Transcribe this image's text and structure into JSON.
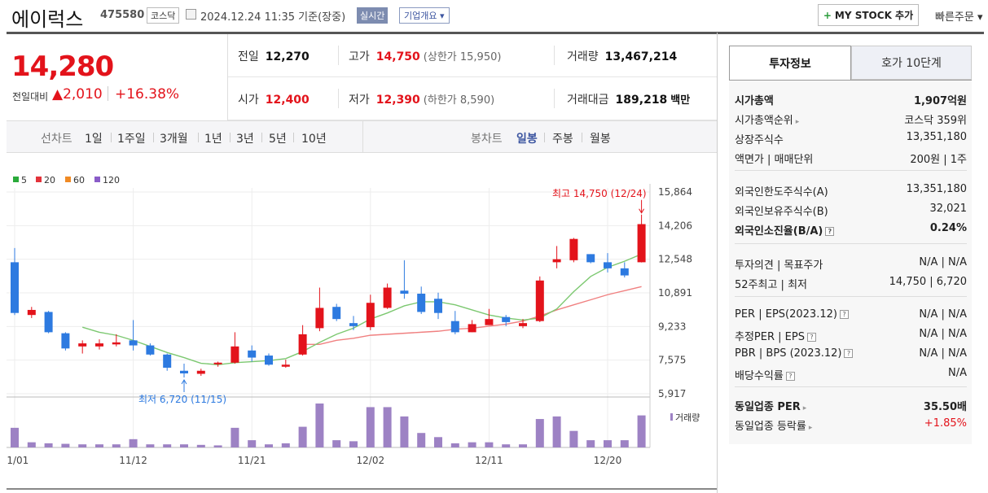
{
  "header": {
    "company_name": "에이럭스",
    "stock_code": "475580",
    "market": "코스닥",
    "datetime": "2024.12.24 11:35 기준(장중)",
    "realtime_badge": "실시간",
    "company_info_btn": "기업개요 ▾",
    "mystock_btn": "MY STOCK 추가",
    "quick_order": "빠른주문 ▾"
  },
  "price": {
    "current": "14,280",
    "diff_label": "전일대비",
    "diff_value": "▲2,010",
    "diff_pct": "+16.38%"
  },
  "stats": {
    "prev_close_label": "전일",
    "prev_close": "12,270",
    "high_label": "고가",
    "high": "14,750",
    "upper_limit": "(상한가 15,950)",
    "volume_label": "거래량",
    "volume": "13,467,214",
    "open_label": "시가",
    "open": "12,400",
    "low_label": "저가",
    "low": "12,390",
    "lower_limit": "(하한가 8,590)",
    "amount_label": "거래대금",
    "amount": "189,218",
    "amount_unit": "백만"
  },
  "period_bar": {
    "line_label": "선차트",
    "line_items": [
      "1일",
      "1주일",
      "3개월",
      "1년",
      "3년",
      "5년",
      "10년"
    ],
    "candle_label": "봉차트",
    "candle_items": [
      "일봉",
      "주봉",
      "월봉"
    ],
    "candle_selected": 0
  },
  "chart_data": {
    "type": "candlestick",
    "legend": [
      {
        "name": "5",
        "color": "#2aaa3a"
      },
      {
        "name": "20",
        "color": "#e3333b"
      },
      {
        "name": "60",
        "color": "#f08a24"
      },
      {
        "name": "120",
        "color": "#8a5cc8"
      }
    ],
    "y_ticks": [
      "15,864",
      "14,206",
      "12,548",
      "10,891",
      "9,233",
      "7,575",
      "5,917"
    ],
    "ylim": [
      5917,
      15864
    ],
    "x_ticks": [
      {
        "label": "11/01",
        "index": 0
      },
      {
        "label": "11/12",
        "index": 7
      },
      {
        "label": "11/21",
        "index": 14
      },
      {
        "label": "12/02",
        "index": 21
      },
      {
        "label": "12/11",
        "index": 28
      },
      {
        "label": "12/20",
        "index": 35
      }
    ],
    "volume_label": "거래량",
    "high_annotation": "최고 14,750 (12/24)",
    "low_annotation": "최저 6,720 (11/15)",
    "up_color": "#e3131b",
    "down_color": "#2d7ae0",
    "candles": [
      {
        "o": 12400,
        "h": 13100,
        "l": 9800,
        "c": 9900,
        "v": 38
      },
      {
        "o": 9800,
        "h": 10200,
        "l": 9650,
        "c": 10050,
        "v": 10
      },
      {
        "o": 9950,
        "h": 10000,
        "l": 8900,
        "c": 8950,
        "v": 8
      },
      {
        "o": 8900,
        "h": 8950,
        "l": 8050,
        "c": 8150,
        "v": 7
      },
      {
        "o": 8250,
        "h": 8550,
        "l": 7900,
        "c": 8400,
        "v": 6
      },
      {
        "o": 8250,
        "h": 8600,
        "l": 8100,
        "c": 8400,
        "v": 6
      },
      {
        "o": 8350,
        "h": 8850,
        "l": 8250,
        "c": 8450,
        "v": 6
      },
      {
        "o": 8550,
        "h": 9550,
        "l": 8050,
        "c": 8300,
        "v": 16
      },
      {
        "o": 8300,
        "h": 8400,
        "l": 7800,
        "c": 7850,
        "v": 6
      },
      {
        "o": 7850,
        "h": 7900,
        "l": 7050,
        "c": 7200,
        "v": 6
      },
      {
        "o": 7050,
        "h": 7400,
        "l": 6720,
        "c": 6920,
        "v": 6
      },
      {
        "o": 6900,
        "h": 7150,
        "l": 6800,
        "c": 7050,
        "v": 5
      },
      {
        "o": 7400,
        "h": 7500,
        "l": 7250,
        "c": 7450,
        "v": 4
      },
      {
        "o": 7450,
        "h": 8950,
        "l": 7400,
        "c": 8250,
        "v": 38
      },
      {
        "o": 8050,
        "h": 8300,
        "l": 7500,
        "c": 7700,
        "v": 14
      },
      {
        "o": 7800,
        "h": 7900,
        "l": 7300,
        "c": 7350,
        "v": 6
      },
      {
        "o": 7250,
        "h": 7600,
        "l": 7200,
        "c": 7350,
        "v": 8
      },
      {
        "o": 7850,
        "h": 9300,
        "l": 7800,
        "c": 8850,
        "v": 40
      },
      {
        "o": 9150,
        "h": 11150,
        "l": 9000,
        "c": 10150,
        "v": 85
      },
      {
        "o": 10200,
        "h": 10350,
        "l": 9500,
        "c": 9600,
        "v": 14
      },
      {
        "o": 9400,
        "h": 9750,
        "l": 9050,
        "c": 9250,
        "v": 12
      },
      {
        "o": 9200,
        "h": 10800,
        "l": 9050,
        "c": 10400,
        "v": 78
      },
      {
        "o": 10150,
        "h": 11350,
        "l": 10100,
        "c": 11150,
        "v": 78
      },
      {
        "o": 11000,
        "h": 12500,
        "l": 10600,
        "c": 10850,
        "v": 60
      },
      {
        "o": 10850,
        "h": 11200,
        "l": 9850,
        "c": 9950,
        "v": 28
      },
      {
        "o": 10600,
        "h": 10900,
        "l": 9600,
        "c": 9900,
        "v": 20
      },
      {
        "o": 9500,
        "h": 10000,
        "l": 8850,
        "c": 8950,
        "v": 8
      },
      {
        "o": 8950,
        "h": 9550,
        "l": 8950,
        "c": 9350,
        "v": 10
      },
      {
        "o": 9300,
        "h": 10100,
        "l": 9300,
        "c": 9600,
        "v": 10
      },
      {
        "o": 9700,
        "h": 9800,
        "l": 9250,
        "c": 9450,
        "v": 6
      },
      {
        "o": 9250,
        "h": 9600,
        "l": 9150,
        "c": 9400,
        "v": 6
      },
      {
        "o": 9500,
        "h": 11700,
        "l": 9450,
        "c": 11500,
        "v": 55
      },
      {
        "o": 12400,
        "h": 13200,
        "l": 12100,
        "c": 12550,
        "v": 60
      },
      {
        "o": 12500,
        "h": 13600,
        "l": 12400,
        "c": 13550,
        "v": 32
      },
      {
        "o": 12800,
        "h": 12800,
        "l": 12350,
        "c": 12400,
        "v": 14
      },
      {
        "o": 12400,
        "h": 12850,
        "l": 11900,
        "c": 12100,
        "v": 14
      },
      {
        "o": 12100,
        "h": 12400,
        "l": 11650,
        "c": 11750,
        "v": 14
      },
      {
        "o": 12400,
        "h": 14750,
        "l": 12390,
        "c": 14280,
        "v": 62
      }
    ],
    "ma5": [
      null,
      null,
      null,
      null,
      9200,
      8950,
      8800,
      8550,
      8250,
      7950,
      7700,
      7420,
      7350,
      7450,
      7500,
      7550,
      7650,
      8000,
      8450,
      8850,
      9150,
      9600,
      9900,
      10250,
      10450,
      10450,
      10300,
      10050,
      9800,
      9650,
      9550,
      9650,
      10100,
      10950,
      11700,
      12150,
      12450,
      12800
    ],
    "ma20": [
      null,
      null,
      null,
      null,
      null,
      null,
      null,
      null,
      null,
      null,
      null,
      null,
      null,
      null,
      null,
      null,
      null,
      8350,
      8350,
      8550,
      8650,
      8800,
      8850,
      8900,
      8950,
      9000,
      9100,
      9150,
      9250,
      9350,
      9500,
      9750,
      10050,
      10300,
      10550,
      10800,
      11000,
      11200
    ]
  },
  "right_panel": {
    "tab_invest": "투자정보",
    "tab_hoga": "호가 10단계",
    "rows1": [
      {
        "l": "시가총액",
        "v": "1,907억원",
        "strong": true
      },
      {
        "l": "시가총액순위",
        "v": "코스닥 359위"
      },
      {
        "l": "상장주식수",
        "v": "13,351,180"
      },
      {
        "l": "액면가 | 매매단위",
        "v": "200원 | 1주"
      }
    ],
    "rows2": [
      {
        "l": "외국인한도주식수(A)",
        "v": "13,351,180"
      },
      {
        "l": "외국인보유주식수(B)",
        "v": "32,021"
      },
      {
        "l": "외국인소진율(B/A)",
        "v": "0.24%",
        "strong": true
      }
    ],
    "rows3": [
      {
        "l": "투자의견 | 목표주가",
        "v": "N/A | N/A"
      },
      {
        "l": "52주최고 | 최저",
        "v": "14,750 | 6,720"
      }
    ],
    "rows4": [
      {
        "l": "PER | EPS(2023.12)",
        "v": "N/A | N/A"
      },
      {
        "l": "추정PER | EPS",
        "v": "N/A | N/A"
      },
      {
        "l": "PBR | BPS (2023.12)",
        "v": "N/A | N/A"
      },
      {
        "l": "배당수익률",
        "v": "N/A"
      }
    ],
    "rows5": [
      {
        "l": "동일업종 PER",
        "v": "35.50배",
        "strong": true
      },
      {
        "l": "동일업종 등락률",
        "v": "+1.85%",
        "red": true
      }
    ],
    "qmark": "?"
  }
}
